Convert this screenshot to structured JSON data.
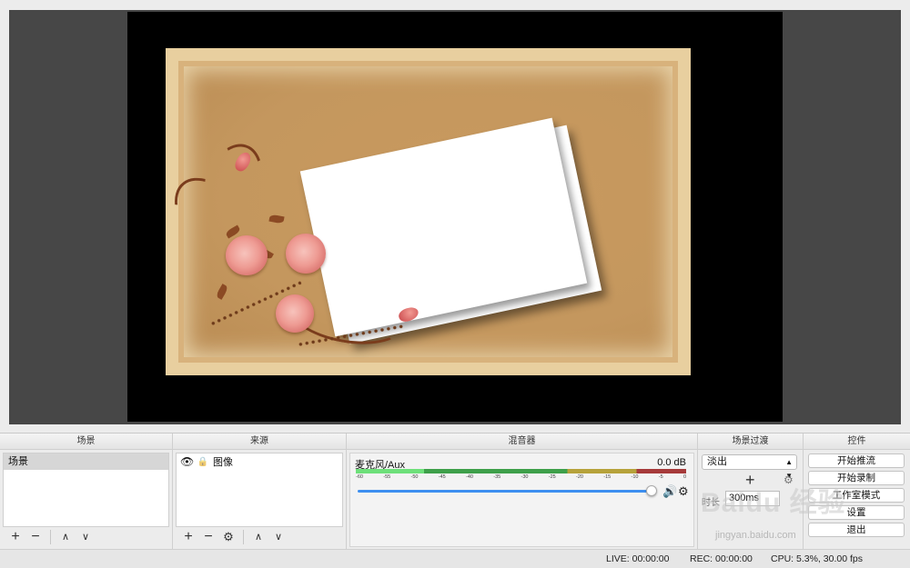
{
  "panels": {
    "scenes": {
      "title": "场景",
      "items": [
        "场景"
      ]
    },
    "sources": {
      "title": "来源",
      "items": [
        {
          "label": "图像"
        }
      ]
    },
    "mixer": {
      "title": "混音器",
      "channel": "麦克风/Aux",
      "level": "0.0 dB",
      "ticks": [
        "-60",
        "-55",
        "-50",
        "-45",
        "-40",
        "-35",
        "-30",
        "-25",
        "-20",
        "-15",
        "-10",
        "-5",
        "0"
      ],
      "volume_fraction": 1.0
    },
    "transitions": {
      "title": "场景过渡",
      "selected": "淡出",
      "duration_label": "时长",
      "duration": "300ms"
    },
    "controls": {
      "title": "控件",
      "buttons": [
        "开始推流",
        "开始录制",
        "工作室模式",
        "设置",
        "退出"
      ]
    }
  },
  "status": {
    "live": "LIVE: 00:00:00",
    "rec": "REC: 00:00:00",
    "cpu": "CPU: 5.3%, 30.00 fps"
  },
  "watermark": {
    "brand": "Baidu 经验",
    "url": "jingyan.baidu.com"
  },
  "icons": {
    "add": "+",
    "remove": "−",
    "up": "∧",
    "down": "∨",
    "settings": "⚙",
    "eye": "👁",
    "lock": "🔒",
    "speaker": "🔊"
  },
  "colors": {
    "meter_green": "#3ea04a",
    "meter_yellow": "#b6a23a",
    "meter_red": "#a63a3a",
    "slider_blue": "#3d8ff0"
  }
}
